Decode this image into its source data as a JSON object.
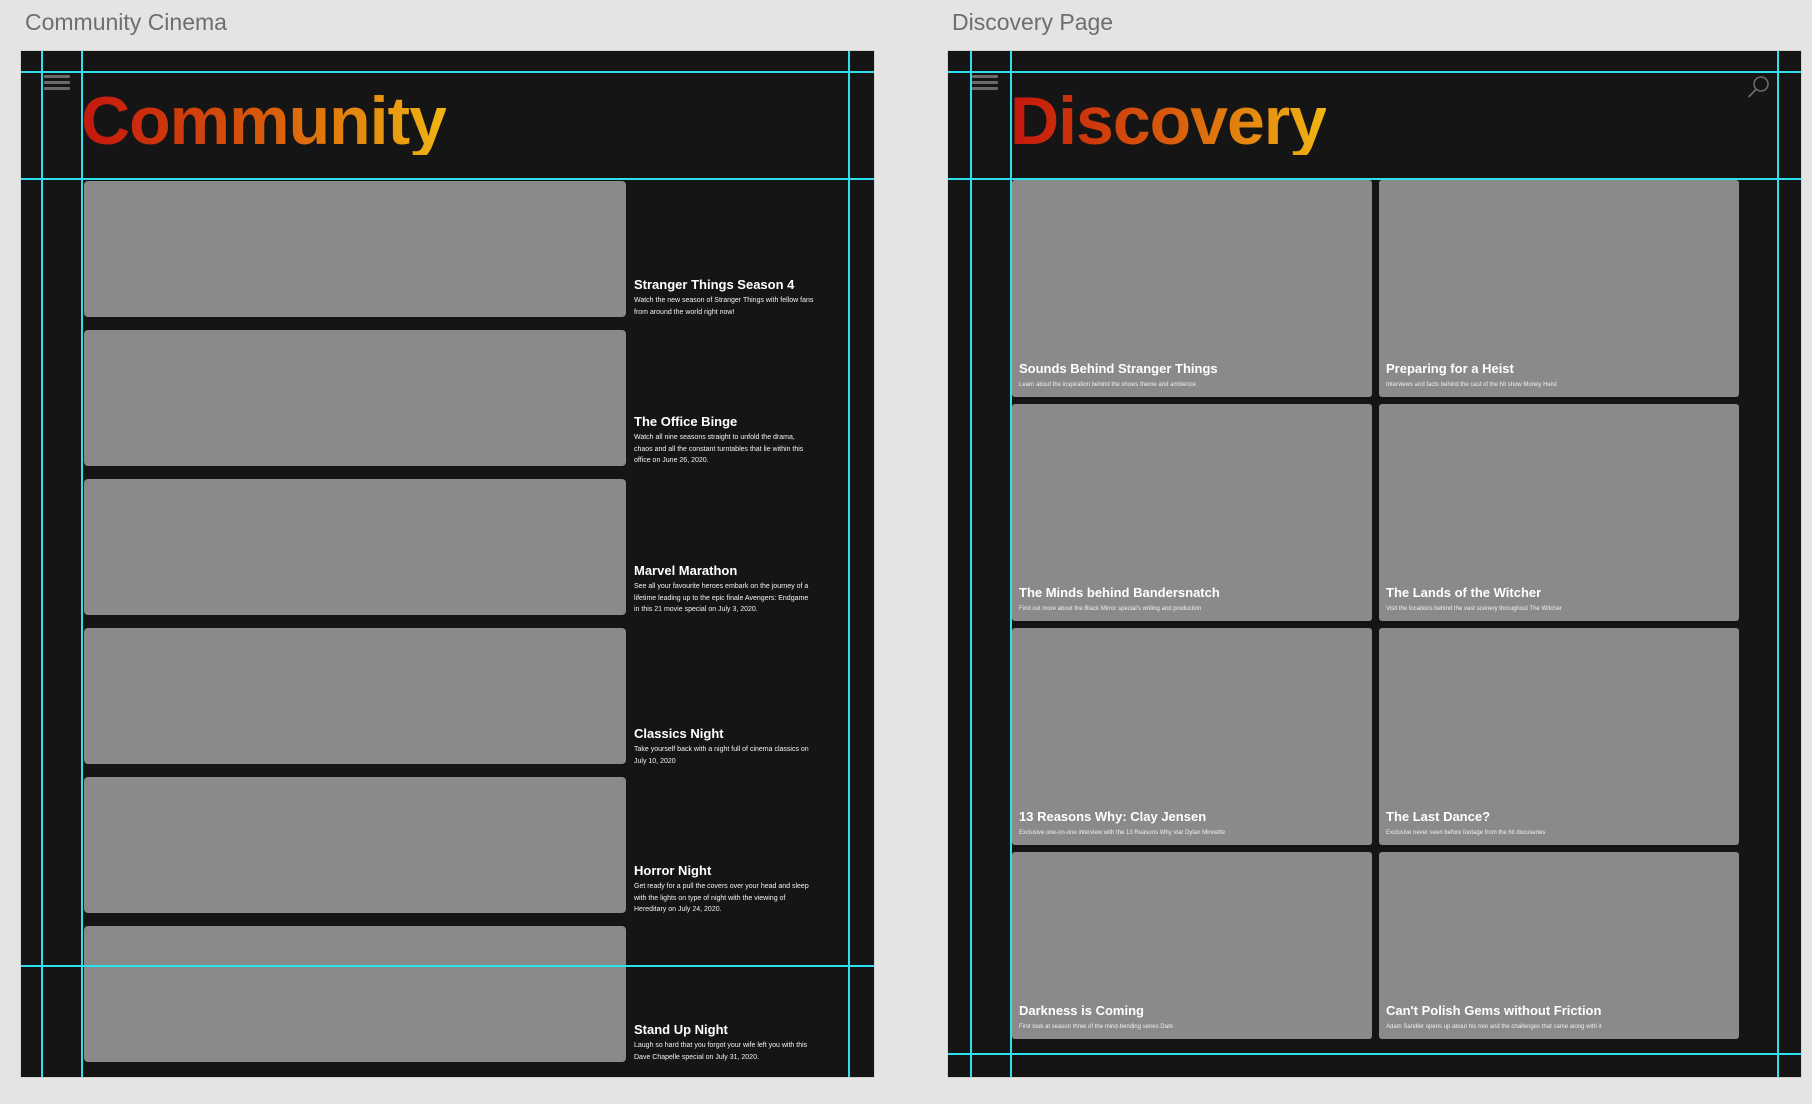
{
  "artboards": {
    "community": {
      "label": "Community Cinema",
      "title": "Community",
      "menu_icon": "hamburger-menu-icon",
      "events": [
        {
          "title": "Stranger Things Season 4",
          "description": "Watch the new season of Stranger Things with fellow fans from around the world right now!"
        },
        {
          "title": "The Office Binge",
          "description": "Watch all nine seasons straight to unfold the drama, chaos and all the constant turntables that lie within this office on June 26, 2020."
        },
        {
          "title": "Marvel Marathon",
          "description": "See all your favourite heroes embark on the journey of a lifetime leading up to the epic finale Avengers: Endgame in this 21 movie special on July 3, 2020."
        },
        {
          "title": "Classics Night",
          "description": "Take yourself back with a night full of cinema classics on July 10, 2020"
        },
        {
          "title": "Horror Night",
          "description": "Get ready for a pull the covers over your head and sleep with the lights on type of night with the viewing of Hereditary on July 24, 2020."
        },
        {
          "title": "Stand Up Night",
          "description": "Laugh so hard that you forgot your wife left you with this Dave Chapelle special on July 31, 2020."
        }
      ]
    },
    "discovery": {
      "label": "Discovery Page",
      "title": "Discovery",
      "menu_icon": "hamburger-menu-icon",
      "search_icon": "search-icon",
      "cards": [
        {
          "title": "Sounds Behind Stranger Things",
          "description": "Learn about the inspiration behind the shows theme and ambience"
        },
        {
          "title": "Preparing for a Heist",
          "description": "Interviews and facts behind the cast of the hit show Money Heist"
        },
        {
          "title": "The Minds behind Bandersnatch",
          "description": "Find out more about the Black Mirror special's writing and production"
        },
        {
          "title": "The Lands of the Witcher",
          "description": "Visit the locations behind the vast scenery throughout The Witcher"
        },
        {
          "title": "13 Reasons Why: Clay Jensen",
          "description": "Exclusive one-on-one interview with the 13 Reasons Why star Dylan Minnette"
        },
        {
          "title": "The Last Dance?",
          "description": "Exclusive never seen before footage from the hit docuseries"
        },
        {
          "title": "Darkness is Coming",
          "description": "First look at season three of the mind-bending series Dark"
        },
        {
          "title": "Can't Polish Gems without Friction",
          "description": "Adam Sandler opens up about his role and the challenges that came along with it"
        }
      ]
    }
  },
  "colors": {
    "canvas": "#e4e4e4",
    "artboard_bg": "#151515",
    "placeholder": "#8a8a8a",
    "guide": "#2ee0ee",
    "title_gradient": [
      "#c4170d",
      "#d75a0b",
      "#f0b512"
    ]
  }
}
